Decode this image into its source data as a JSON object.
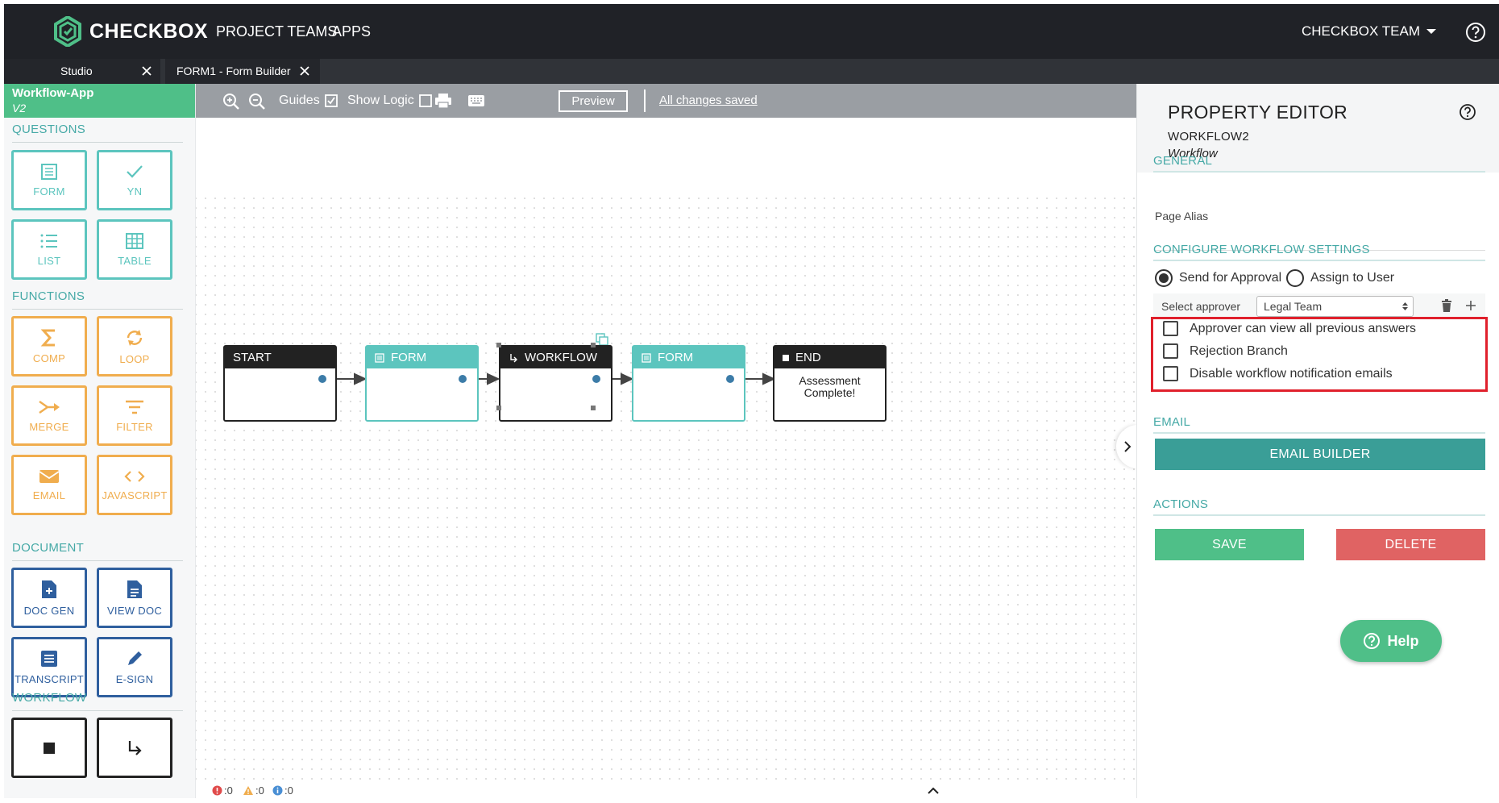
{
  "topbar": {
    "brand": "CHECKBOX",
    "nav": [
      "PROJECT TEAMS",
      "APPS"
    ],
    "team_menu": "CHECKBOX TEAM"
  },
  "tabs": [
    {
      "label": "Studio"
    },
    {
      "label": "FORM1 - Form Builder"
    }
  ],
  "sidebar": {
    "app_name": "Workflow-App",
    "app_version": "V2",
    "sections": {
      "questions": "QUESTIONS",
      "functions": "FUNCTIONS",
      "document": "DOCUMENT",
      "workflow": "WORKFLOW"
    },
    "questions": [
      "FORM",
      "YN",
      "LIST",
      "TABLE"
    ],
    "functions": [
      "COMP",
      "LOOP",
      "MERGE",
      "FILTER",
      "EMAIL",
      "JAVASCRIPT"
    ],
    "document": [
      "DOC GEN",
      "VIEW DOC",
      "TRANSCRIPT",
      "E-SIGN"
    ]
  },
  "toolbar": {
    "guides": "Guides",
    "show_logic": "Show Logic",
    "preview": "Preview",
    "saved": "All changes saved"
  },
  "canvas": {
    "nodes": [
      {
        "label": "START",
        "body": ""
      },
      {
        "label": "FORM",
        "body": ""
      },
      {
        "label": "WORKFLOW",
        "body": ""
      },
      {
        "label": "FORM",
        "body": ""
      },
      {
        "label": "END",
        "body": "Assessment Complete!"
      }
    ]
  },
  "status": {
    "errors": ":0",
    "warnings": ":0",
    "info": ":0"
  },
  "panel": {
    "title": "PROPERTY EDITOR",
    "subtitle": "WORKFLOW2",
    "type": "Workflow",
    "general_heading": "GENERAL",
    "page_alias_label": "Page Alias",
    "config_heading": "CONFIGURE WORKFLOW SETTINGS",
    "radio_approval": "Send for Approval",
    "radio_assign": "Assign to User",
    "select_approver_label": "Select approver",
    "approver_value": "Legal Team",
    "checkboxes": [
      "Approver can view all previous answers",
      "Rejection Branch",
      "Disable workflow notification emails"
    ],
    "email_heading": "EMAIL",
    "email_builder": "EMAIL BUILDER",
    "actions_heading": "ACTIONS",
    "save": "SAVE",
    "delete": "DELETE",
    "help": "Help"
  },
  "colors": {
    "green": "#4fbf88",
    "teal": "#5cc5be",
    "orange": "#f0ad4e",
    "navy": "#2f5f9e",
    "red": "#e06363",
    "email_builder": "#3a9e97",
    "highlight": "#e0202c"
  }
}
